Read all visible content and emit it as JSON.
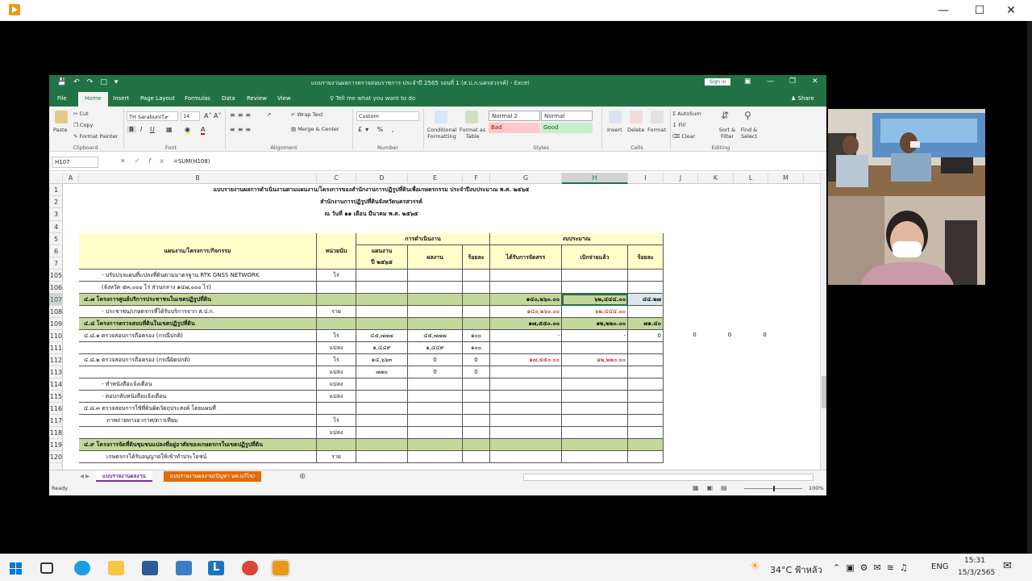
{
  "excel": {
    "doc_title": "แบบรายงานผลการตรวจสอบราชการ ประจำปี 2565 รอบที่ 1 (ส.ป.ก.นครสวรรค์) - Excel",
    "sign_in": "Sign in",
    "tabs": [
      "File",
      "Home",
      "Insert",
      "Page Layout",
      "Formulas",
      "Data",
      "Review",
      "View"
    ],
    "tell_me": "Tell me what you want to do",
    "share": "Share",
    "ribbon": {
      "paste": "Paste",
      "cut": "Cut",
      "copy": "Copy",
      "format_painter": "Format Painter",
      "font_name": "TH SarabunIT๙",
      "font_size": "14",
      "wrap_text": "Wrap Text",
      "merge_center": "Merge & Center",
      "number_format": "Custom",
      "cond_format": "Conditional Formatting",
      "format_table": "Format as Table",
      "style_normal2": "Normal 2",
      "style_normal": "Normal",
      "style_bad": "Bad",
      "style_good": "Good",
      "insert": "Insert",
      "delete": "Delete",
      "format": "Format",
      "autosum": "AutoSum",
      "fill": "Fill",
      "clear": "Clear",
      "sort_filter": "Sort & Filter",
      "find_select": "Find & Select",
      "groups": [
        "Clipboard",
        "Font",
        "Alignment",
        "Number",
        "Styles",
        "Cells",
        "Editing"
      ]
    },
    "name_box": "H107",
    "formula": "=SUM(H108)",
    "columns": [
      "A",
      "B",
      "C",
      "D",
      "E",
      "F",
      "G",
      "H",
      "I",
      "J",
      "K",
      "L",
      "M"
    ],
    "title_rows": [
      "แบบรายงานผลการดำเนินงานตามแผนงาน/โครงการของสำนักงานการปฏิรูปที่ดินเพื่อเกษตรกรรม ประจำปีงบประมาณ พ.ศ. ๒๕๖๕",
      "สำนักงานการปฏิรูปที่ดินจังหวัดนครสวรรค์",
      "ณ วันที่ ๑๑ เดือน มีนาคม พ.ศ. ๒๕๖๕"
    ],
    "header": {
      "plan": "แผนงาน/โครงการ/กิจกรรม",
      "unit": "หน่วยนับ",
      "operation": "การดำเนินงาน",
      "budget": "งบประมาณ",
      "target": "แผนงาน",
      "target_year": "ปี ๒๕๖๕",
      "result": "ผลงาน",
      "percent": "ร้อยละ",
      "allocated": "ได้รับการจัดสรร",
      "disbursed": "เบิกจ่ายแล้ว",
      "percent2": "ร้อยละ"
    },
    "rows": [
      {
        "n": "105",
        "b": "- ปรับปรุงแผนที่แปลงที่ดินตามมาตรฐาน RTK GNSS NETWORK",
        "c": "ไร่",
        "d": "",
        "e": "",
        "f": "",
        "g": "",
        "h": "",
        "i": ""
      },
      {
        "n": "106",
        "b": "(จังหวัด ๕๓,๐๐๐ ไร่ ส่วนกลาง ๑๔๗,๐๐๐ ไร่)",
        "c": "",
        "d": "",
        "e": "",
        "f": "",
        "g": "",
        "h": "",
        "i": ""
      },
      {
        "n": "107",
        "b": "๔.๗ โครงการศูนย์บริการประชาชนในเขตปฏิรูปที่ดิน",
        "c": "",
        "d": "",
        "e": "",
        "f": "",
        "g": "๑๔๐,๒๖๐.๐๐",
        "h": "๖๒,๔๔๔.๐๐",
        "i": "๔๔.๒๗",
        "green": true
      },
      {
        "n": "108",
        "b": "- ประชาชน/เกษตรกรที่ได้รับบริการจาก ส.ป.ก.",
        "c": "ราย",
        "d": "",
        "e": "",
        "f": "",
        "g": "๑๔๐,๒๖๐.๐๐",
        "h": "๖๒,๔๔๔.๐๐",
        "i": "",
        "red": true
      },
      {
        "n": "109",
        "b": "๔.๘ โครงการตรวจสอบที่ดินในเขตปฏิรูปที่ดิน",
        "c": "",
        "d": "",
        "e": "",
        "f": "",
        "g": "๑๗,๕๕๐.๐๐",
        "h": "๑๒,๒๒๐.๐๐",
        "i": "๗๑.๔๐",
        "green": true
      },
      {
        "n": "110",
        "b": "๔.๘.๑ ตรวจสอบการถือครอง (กรณีปกติ)",
        "c": "ไร่",
        "d": "๔๕,๗๗๗",
        "e": "๔๕,๗๗๗",
        "f": "๑๐๐",
        "g": "-",
        "h": "-",
        "i": "0"
      },
      {
        "n": "111",
        "b": "",
        "c": "แปลง",
        "d": "๑,๔๔๙",
        "e": "๑,๔๔๙",
        "f": "๑๐๐",
        "g": "",
        "h": "",
        "i": ""
      },
      {
        "n": "112",
        "b": "๔.๘.๒ ตรวจสอบการถือครอง (กรณีผิดปกติ)",
        "c": "ไร่",
        "d": "๑๔,๖๖๓",
        "e": "0",
        "f": "0",
        "g": "๑๗,๕๕๐.๐๐",
        "h": "๑๒,๒๒๐.๐๐",
        "i": "",
        "red": true
      },
      {
        "n": "113",
        "b": "",
        "c": "แปลง",
        "d": "๗๗๐",
        "e": "0",
        "f": "0",
        "g": "",
        "h": "",
        "i": ""
      },
      {
        "n": "114",
        "b": "- ทำหนังสือแจ้งเตือน",
        "c": "แปลง",
        "d": "",
        "e": "",
        "f": "",
        "g": "",
        "h": "",
        "i": ""
      },
      {
        "n": "115",
        "b": "- ตอบกลับหนังสือแจ้งเตือน",
        "c": "แปลง",
        "d": "",
        "e": "",
        "f": "",
        "g": "",
        "h": "",
        "i": ""
      },
      {
        "n": "116",
        "b": "๔.๘.๓ ตรวจสอบการใช้ที่ดินผิดวัตถุประสงค์ โดยแผนที่",
        "c": "",
        "d": "",
        "e": "",
        "f": "",
        "g": "",
        "h": "",
        "i": ""
      },
      {
        "n": "117",
        "b": "ภาพถ่ายทางอากาศ/ดาวเทียม",
        "c": "ไร่",
        "d": "",
        "e": "",
        "f": "",
        "g": "",
        "h": "",
        "i": ""
      },
      {
        "n": "118",
        "b": "",
        "c": "แปลง",
        "d": "",
        "e": "",
        "f": "",
        "g": "",
        "h": "",
        "i": ""
      },
      {
        "n": "119",
        "b": "๔.๙ โครงการจัดที่ดินชุมชนแปลงที่อยู่อาศัยของเกษตรกรในเขตปฏิรูปที่ดิน",
        "c": "",
        "d": "",
        "e": "",
        "f": "",
        "g": "",
        "h": "",
        "i": "",
        "green": true
      },
      {
        "n": "120",
        "b": "เกษตรกรได้รับอนุญาตให้เข้าทำประโยชน์",
        "c": "ราย",
        "d": "",
        "e": "",
        "f": "",
        "g": "",
        "h": "",
        "i": ""
      }
    ],
    "stray_zeros": [
      "0",
      "0",
      "0"
    ],
    "sheet_tabs": [
      "แบบรายงานผลงาน",
      "แบบรายงานผลงาน(ปัญหา นท.แก้ไข)"
    ],
    "status": "Ready",
    "zoom": "100%"
  },
  "taskbar": {
    "weather": "34°C ฟ้าหลัว",
    "lang": "ENG",
    "time": "15:31",
    "date": "15/3/2565"
  }
}
